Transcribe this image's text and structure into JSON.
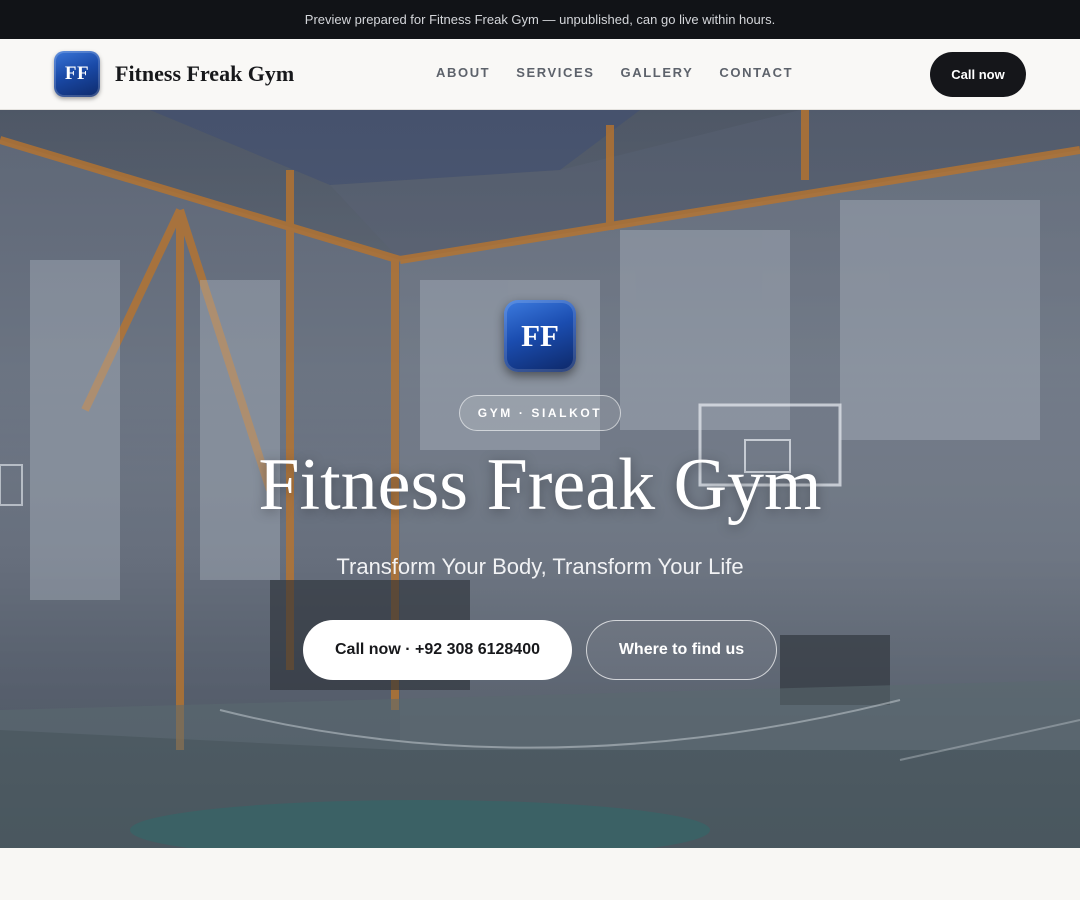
{
  "banner": {
    "text": "Preview prepared for Fitness Freak Gym — unpublished, can go live within hours."
  },
  "header": {
    "logo_text": "FF",
    "brand_name": "Fitness Freak Gym",
    "nav": [
      {
        "label": "ABOUT"
      },
      {
        "label": "SERVICES"
      },
      {
        "label": "GALLERY"
      },
      {
        "label": "CONTACT"
      }
    ],
    "call_label": "Call now"
  },
  "hero": {
    "logo_text": "FF",
    "tag": "GYM · SIALKOT",
    "title": "Fitness Freak Gym",
    "subtitle": "Transform Your Body, Transform Your Life",
    "primary_button": "Call now · +92 308 6128400",
    "secondary_button": "Where to find us"
  },
  "colors": {
    "banner_bg": "#111317",
    "header_bg": "#f9f8f6",
    "dark_button": "#15161a",
    "logo_blue": "#1b4db0"
  },
  "icons": {
    "brand_logo": "ff-logo-icon",
    "hero_logo": "ff-logo-icon"
  }
}
